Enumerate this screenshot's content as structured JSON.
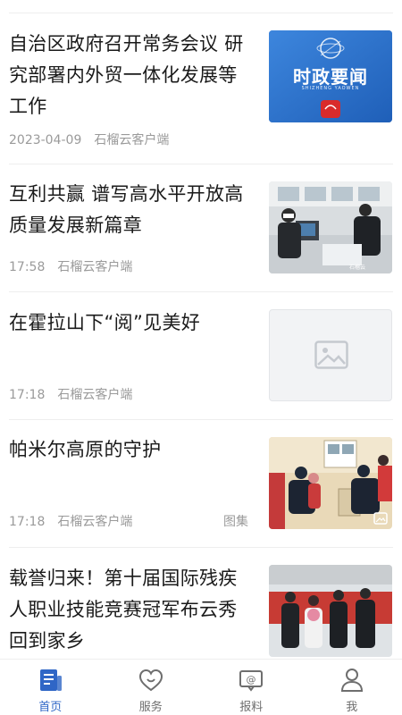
{
  "articles": [
    {
      "title": "自治区政府召开常务会议 研究部署内外贸一体化发展等工作",
      "time": "2023-04-09",
      "source": "石榴云客户端",
      "tag": "",
      "thumb": {
        "kind": "banner",
        "banner_title": "时政要闻",
        "banner_sub": "SHIZHENG YAOWEN"
      }
    },
    {
      "title": "互利共赢 谱写高水平开放高质量发展新篇章",
      "time": "17:58",
      "source": "石榴云客户端",
      "tag": "",
      "thumb": {
        "kind": "photo-office"
      }
    },
    {
      "title": "在霍拉山下“阅”见美好",
      "time": "17:18",
      "source": "石榴云客户端",
      "tag": "",
      "thumb": {
        "kind": "placeholder"
      }
    },
    {
      "title": "帕米尔高原的守护",
      "time": "17:18",
      "source": "石榴云客户端",
      "tag": "图集",
      "thumb": {
        "kind": "photo-police"
      }
    },
    {
      "title": "载誉归来！第十届国际残疾人职业技能竞赛冠军布云秀回到家乡",
      "time": "",
      "source": "",
      "tag": "",
      "thumb": {
        "kind": "photo-group"
      }
    }
  ],
  "tabbar": {
    "tabs": [
      {
        "label": "首页",
        "icon": "news-icon",
        "active": true
      },
      {
        "label": "服务",
        "icon": "heart-icon",
        "active": false
      },
      {
        "label": "报料",
        "icon": "report-icon",
        "active": false
      },
      {
        "label": "我",
        "icon": "user-icon",
        "active": false
      }
    ]
  },
  "colors": {
    "accent": "#2f66c6",
    "meta_text": "#9a9a9a",
    "banner_blue": "#2a6fc8"
  }
}
